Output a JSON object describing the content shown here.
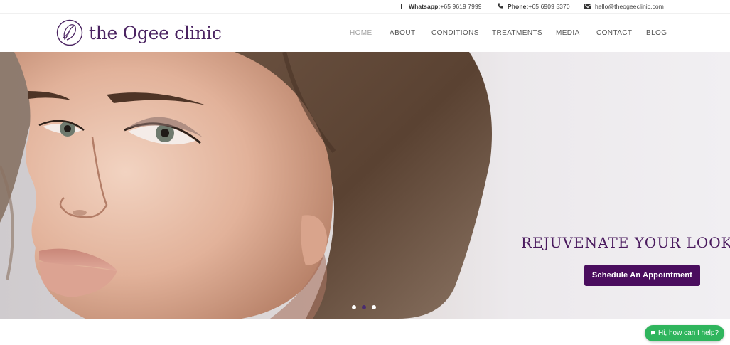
{
  "topbar": {
    "whatsapp_label": "Whatsapp:",
    "whatsapp_value": "+65 9619 7999",
    "phone_label": "Phone:",
    "phone_value": "+65 6909 5370",
    "email": "hello@theogeeclinic.com",
    "icons": [
      "mobile-phone-icon",
      "phone-icon",
      "envelope-icon"
    ]
  },
  "header": {
    "logo_text": "the Ogee clinic",
    "brand_color": "#4b2462"
  },
  "nav": {
    "items": [
      {
        "label": "HOME",
        "active": true
      },
      {
        "label": "ABOUT",
        "active": false
      },
      {
        "label": "CONDITIONS",
        "active": false
      },
      {
        "label": "TREATMENTS",
        "active": false
      },
      {
        "label": "MEDIA",
        "active": false
      },
      {
        "label": "CONTACT",
        "active": false
      },
      {
        "label": "BLOG",
        "active": false
      }
    ]
  },
  "hero": {
    "title": "REJUVENATE YOUR LOOK",
    "cta_label": "Schedule An Appointment",
    "cta_color": "#4a0d5e",
    "slides": 3,
    "active_slide": 2
  },
  "chat": {
    "label": "Hi, how can I help?",
    "icon": "chat-icon",
    "color": "#2fb55d"
  }
}
